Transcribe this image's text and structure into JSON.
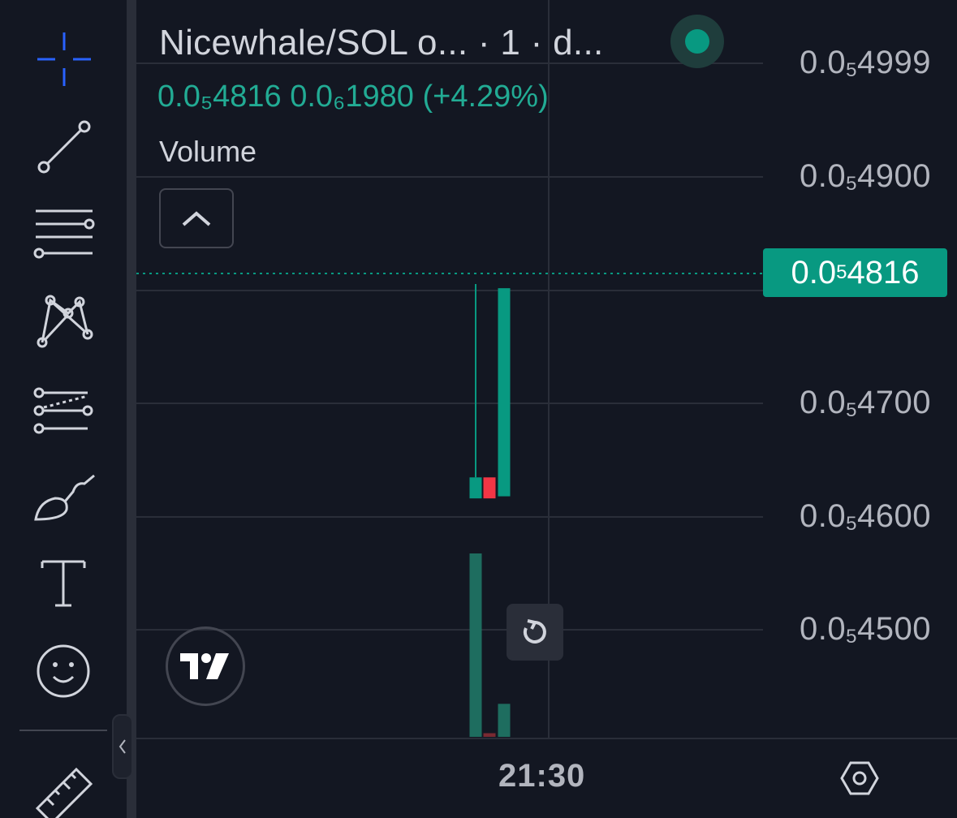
{
  "symbol": {
    "title": "Nicewhale/SOL o...  · 1 · d...",
    "price_display": "0.0₅4816",
    "change_display": "0.0₆1980",
    "change_percent": "(+4.29%)"
  },
  "legend": {
    "volume_label": "Volume"
  },
  "price_axis": {
    "labels": [
      {
        "base": "0.0",
        "sub": "5",
        "rest": "4999"
      },
      {
        "base": "0.0",
        "sub": "5",
        "rest": "4900"
      },
      {
        "base": "0.0",
        "sub": "5",
        "rest": "4700"
      },
      {
        "base": "0.0",
        "sub": "5",
        "rest": "4600"
      },
      {
        "base": "0.0",
        "sub": "5",
        "rest": "4500"
      }
    ],
    "current": {
      "base": "0.0",
      "sub": "5",
      "rest": "4816"
    }
  },
  "time_axis": {
    "label": "21:30"
  },
  "toolbar": {
    "tools": [
      "crosshair-icon",
      "trend-line-icon",
      "fib-retracement-icon",
      "pattern-icon",
      "forecast-icon",
      "brush-icon",
      "text-icon",
      "emoji-icon",
      "ruler-icon"
    ]
  },
  "colors": {
    "up": "#089981",
    "down": "#f23645",
    "accent_blue": "#2962ff",
    "background": "#131722"
  },
  "chart_data": {
    "type": "candlestick",
    "price_ylim": [
      4.42e-06,
      5.03e-06
    ],
    "candles": [
      {
        "open": 4.616e-06,
        "high": 4.82e-06,
        "low": 4.616e-06,
        "close": 4.636e-06,
        "direction": "up"
      },
      {
        "open": 4.636e-06,
        "high": 4.636e-06,
        "low": 4.616e-06,
        "close": 4.616e-06,
        "direction": "down"
      },
      {
        "open": 4.618e-06,
        "high": 4.816e-06,
        "low": 4.618e-06,
        "close": 4.816e-06,
        "direction": "up"
      }
    ],
    "volume_relative": [
      1.0,
      0.02,
      0.18
    ],
    "current_price": 4.816e-06
  }
}
